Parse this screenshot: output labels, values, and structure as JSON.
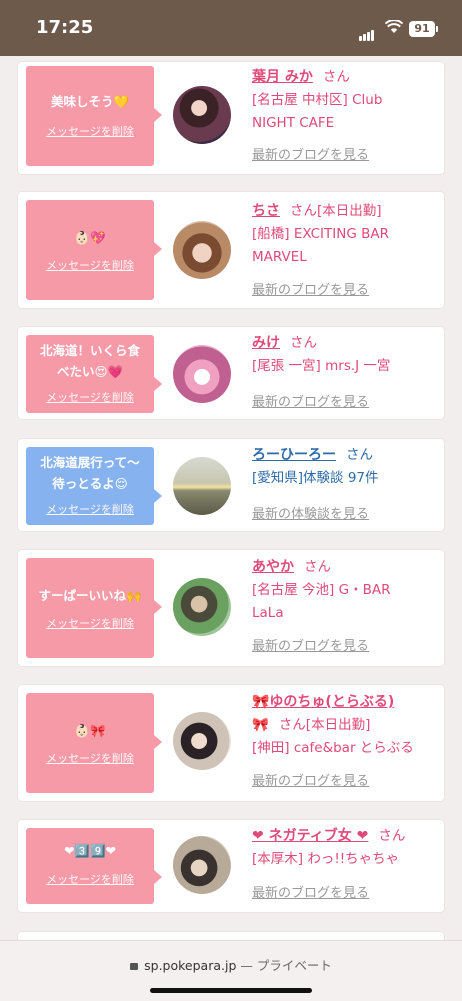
{
  "status": {
    "time": "17:25",
    "battery": "91"
  },
  "cards": [
    {
      "message": "美味しそう💛",
      "delete": "メッセージを削除",
      "name": "葉月 みか",
      "san": "さん",
      "shop_lines": [
        "[名古屋 中村区] Club",
        "NIGHT CAFE"
      ],
      "link": "最新のブログを見る"
    },
    {
      "message": "👶🏻💖",
      "delete": "メッセージを削除",
      "name": "ちさ",
      "san": "さん[本日出勤]",
      "shop_lines": [
        "[船橋] EXCITING BAR",
        "MARVEL"
      ],
      "link": "最新のブログを見る"
    },
    {
      "message_lines": [
        "北海道！いくら食",
        "べたい😍💗"
      ],
      "delete": "メッセージを削除",
      "name": "みけ",
      "san": "さん",
      "shop_lines": [
        "[尾張 一宮] mrs.J 一宮"
      ],
      "link": "最新のブログを見る"
    },
    {
      "message_lines": [
        "北海道展行って〜",
        "待っとるよ😌"
      ],
      "delete": "メッセージを削除",
      "name": "ろーひーろー",
      "san": "さん",
      "shop_lines": [
        "[愛知県]体験談 97件"
      ],
      "link": "最新の体験談を見る",
      "variant": "blue"
    },
    {
      "message": "すーぱーいいね🙌",
      "delete": "メッセージを削除",
      "name": "あやか",
      "san": "さん",
      "shop_lines": [
        "[名古屋 今池] G・BAR",
        "LaLa"
      ],
      "link": "最新のブログを見る"
    },
    {
      "message": "👶🏻🎀",
      "delete": "メッセージを削除",
      "name": "🎀ゆのちゅ(とらぶる)",
      "name2": "🎀",
      "san": "さん[本日出勤]",
      "shop_lines": [
        "[神田] cafe&bar とらぶる"
      ],
      "link": "最新のブログを見る"
    },
    {
      "message": "❤3️⃣9️⃣❤",
      "delete": "メッセージを削除",
      "name": "❤ ネガティブ女 ❤",
      "san": "さん",
      "shop_lines": [
        "[本厚木] わっ!!ちゃちゃ"
      ],
      "link": "最新のブログを見る"
    }
  ],
  "url": {
    "domain": "sp.pokepara.jp",
    "suffix": "— プライベート"
  }
}
